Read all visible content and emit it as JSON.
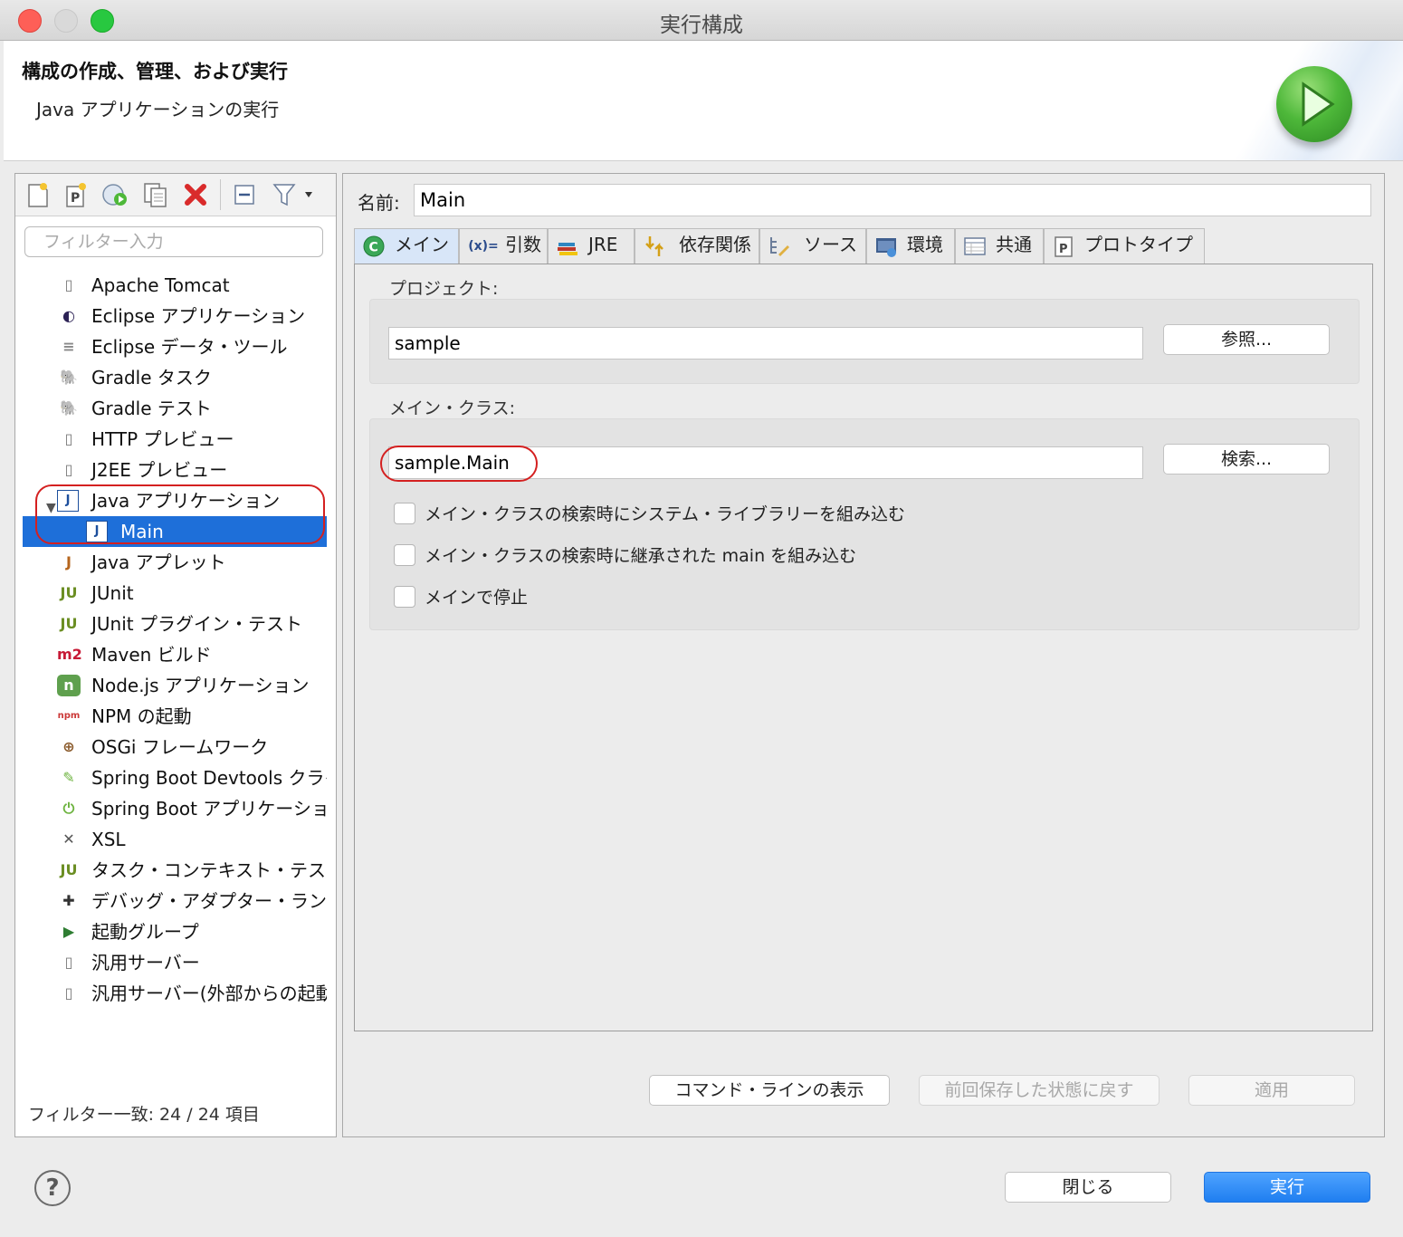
{
  "window": {
    "title": "実行構成"
  },
  "header": {
    "title": "構成の作成、管理、および実行",
    "subtitle": "Java アプリケーションの実行",
    "icon": "run-icon"
  },
  "left": {
    "toolbar_icons": [
      "new-config-icon",
      "new-prototype-icon",
      "export-icon",
      "duplicate-icon",
      "delete-icon",
      "collapse-all-icon",
      "filter-icon"
    ],
    "filter_placeholder": "フィルター入力",
    "tree": [
      {
        "label": "Apache Tomcat",
        "icon": "server-icon"
      },
      {
        "label": "Eclipse アプリケーション",
        "icon": "eclipse-icon"
      },
      {
        "label": "Eclipse データ・ツール",
        "icon": "database-icon"
      },
      {
        "label": "Gradle タスク",
        "icon": "gradle-icon"
      },
      {
        "label": "Gradle テスト",
        "icon": "gradle-test-icon"
      },
      {
        "label": "HTTP プレビュー",
        "icon": "server-icon"
      },
      {
        "label": "J2EE プレビュー",
        "icon": "server-icon"
      },
      {
        "label": "Java アプリケーション",
        "icon": "java-app-icon",
        "expanded": true
      },
      {
        "label": "Main",
        "icon": "java-app-icon",
        "child": true,
        "selected": true
      },
      {
        "label": "Java アプレット",
        "icon": "applet-icon"
      },
      {
        "label": "JUnit",
        "icon": "junit-icon"
      },
      {
        "label": "JUnit プラグイン・テスト",
        "icon": "junit-plugin-icon"
      },
      {
        "label": "Maven ビルド",
        "icon": "maven-icon"
      },
      {
        "label": "Node.js アプリケーション",
        "icon": "nodejs-icon"
      },
      {
        "label": "NPM の起動",
        "icon": "npm-icon"
      },
      {
        "label": "OSGi フレームワーク",
        "icon": "osgi-icon"
      },
      {
        "label": "Spring Boot Devtools クライ",
        "icon": "spring-devtools-icon"
      },
      {
        "label": "Spring Boot アプリケーション",
        "icon": "spring-boot-icon"
      },
      {
        "label": "XSL",
        "icon": "xsl-icon"
      },
      {
        "label": "タスク・コンテキスト・テスト",
        "icon": "task-context-icon"
      },
      {
        "label": "デバッグ・アダプター・ランチャー",
        "icon": "debug-adapter-icon"
      },
      {
        "label": "起動グループ",
        "icon": "launch-group-icon"
      },
      {
        "label": "汎用サーバー",
        "icon": "server-icon"
      },
      {
        "label": "汎用サーバー(外部からの起動)",
        "icon": "server-icon"
      }
    ],
    "filter_count": "フィルター一致: 24 / 24 項目"
  },
  "right": {
    "name_label": "名前:",
    "name_value": "Main",
    "tabs": [
      {
        "label": "メイン",
        "icon": "main-class-icon",
        "active": true
      },
      {
        "label": "引数",
        "icon": "arguments-icon"
      },
      {
        "label": "JRE",
        "icon": "jre-icon"
      },
      {
        "label": "依存関係",
        "icon": "dependencies-icon"
      },
      {
        "label": "ソース",
        "icon": "source-icon"
      },
      {
        "label": "環境",
        "icon": "environment-icon"
      },
      {
        "label": "共通",
        "icon": "common-icon"
      },
      {
        "label": "プロトタイプ",
        "icon": "prototype-icon"
      }
    ],
    "project_label": "プロジェクト:",
    "project_value": "sample",
    "browse_button": "参照...",
    "main_class_label": "メイン・クラス:",
    "main_class_value": "sample.Main",
    "search_button": "検索...",
    "checkboxes": [
      {
        "label": "メイン・クラスの検索時にシステム・ライブラリーを組み込む",
        "checked": false
      },
      {
        "label": "メイン・クラスの検索時に継承された main を組み込む",
        "checked": false
      },
      {
        "label": "メインで停止",
        "checked": false
      }
    ],
    "show_command_line_button": "コマンド・ラインの表示",
    "revert_button": "前回保存した状態に戻す",
    "apply_button": "適用"
  },
  "footer": {
    "close_button": "閉じる",
    "run_button": "実行",
    "help_icon": "help-icon"
  },
  "colors": {
    "selection": "#1e6fd9",
    "run_button": "#1f7ef0",
    "annotation": "#d42020"
  }
}
